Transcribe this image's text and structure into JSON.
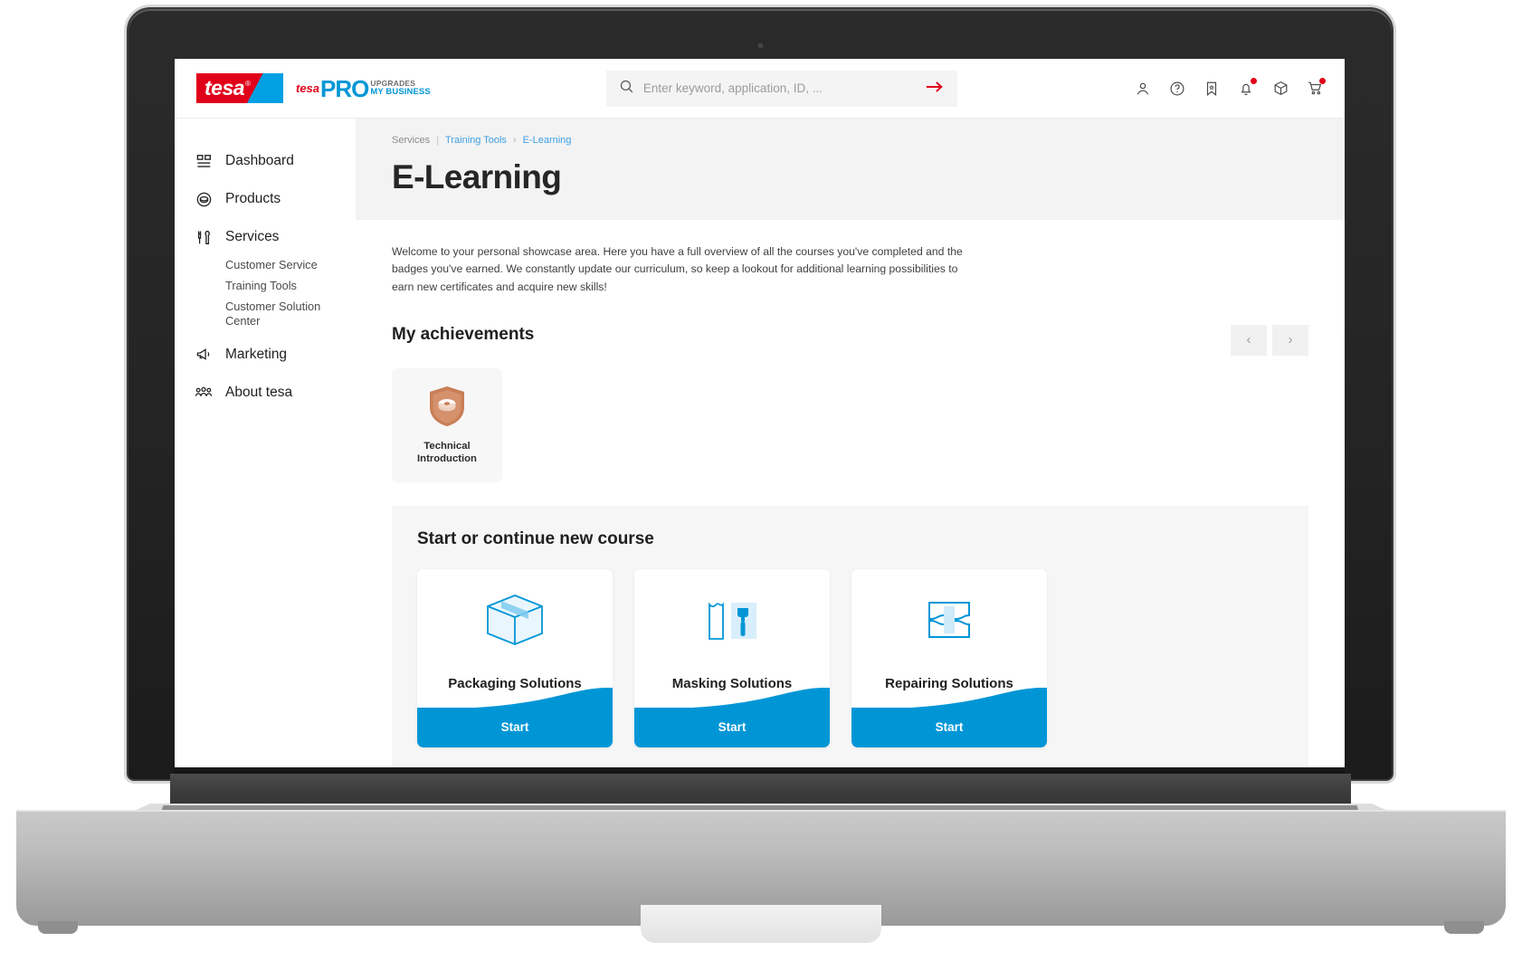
{
  "brand": {
    "logo_text": "tesa",
    "logo_registered": "®",
    "pro_tesa": "tesa",
    "pro_tesa_sup": "®",
    "pro_word": "PRO",
    "pro_line1": "UPGRADES",
    "pro_line2": "MY BUSINESS",
    "red": "#e1001a",
    "blue": "#0096d6"
  },
  "search": {
    "placeholder": "Enter keyword, application, ID, ...",
    "value": "",
    "icon": "search-icon",
    "submit_icon": "arrow-right-icon"
  },
  "header_icons": [
    {
      "name": "user-account-icon",
      "badge": false
    },
    {
      "name": "help-question-icon",
      "badge": false
    },
    {
      "name": "bookmark-star-icon",
      "badge": false
    },
    {
      "name": "notifications-bell-icon",
      "badge": true
    },
    {
      "name": "package-box-icon",
      "badge": false
    },
    {
      "name": "shopping-cart-icon",
      "badge": true
    }
  ],
  "sidebar": {
    "items": [
      {
        "label": "Dashboard",
        "icon": "dashboard-grid-icon",
        "active": false
      },
      {
        "label": "Products",
        "icon": "tape-roll-icon",
        "active": false
      },
      {
        "label": "Services",
        "icon": "tools-wrench-screwdriver-icon",
        "active": true
      },
      {
        "label": "Marketing",
        "icon": "megaphone-icon",
        "active": false
      },
      {
        "label": "About tesa",
        "icon": "people-group-icon",
        "active": false
      }
    ],
    "services_sub": [
      {
        "label": "Customer Service"
      },
      {
        "label": "Training Tools"
      },
      {
        "label": "Customer Solution Center"
      }
    ]
  },
  "breadcrumb": {
    "root": "Services",
    "separator": "|",
    "link": "Training Tools",
    "chevron": "›",
    "current": "E-Learning"
  },
  "page": {
    "title": "E-Learning",
    "intro": "Welcome to your personal showcase area. Here you have a full overview of all the courses you've completed and the badges you've earned. We constantly update our curriculum, so keep a lookout for additional learning possibilities to earn new certificates and acquire new skills!"
  },
  "achievements": {
    "title": "My achievements",
    "prev_label": "‹",
    "next_label": "›",
    "badges": [
      {
        "title_line1": "Technical",
        "title_line2": "Introduction",
        "icon": "shield-badge-tape-icon",
        "color": "#c97e56"
      }
    ]
  },
  "courses": {
    "title": "Start or continue new course",
    "items": [
      {
        "name": "Packaging Solutions",
        "icon": "carton-box-icon",
        "cta": "Start"
      },
      {
        "name": "Masking Solutions",
        "icon": "masking-tape-brush-icon",
        "cta": "Start"
      },
      {
        "name": "Repairing Solutions",
        "icon": "repair-patch-icon",
        "cta": "Start"
      }
    ]
  }
}
